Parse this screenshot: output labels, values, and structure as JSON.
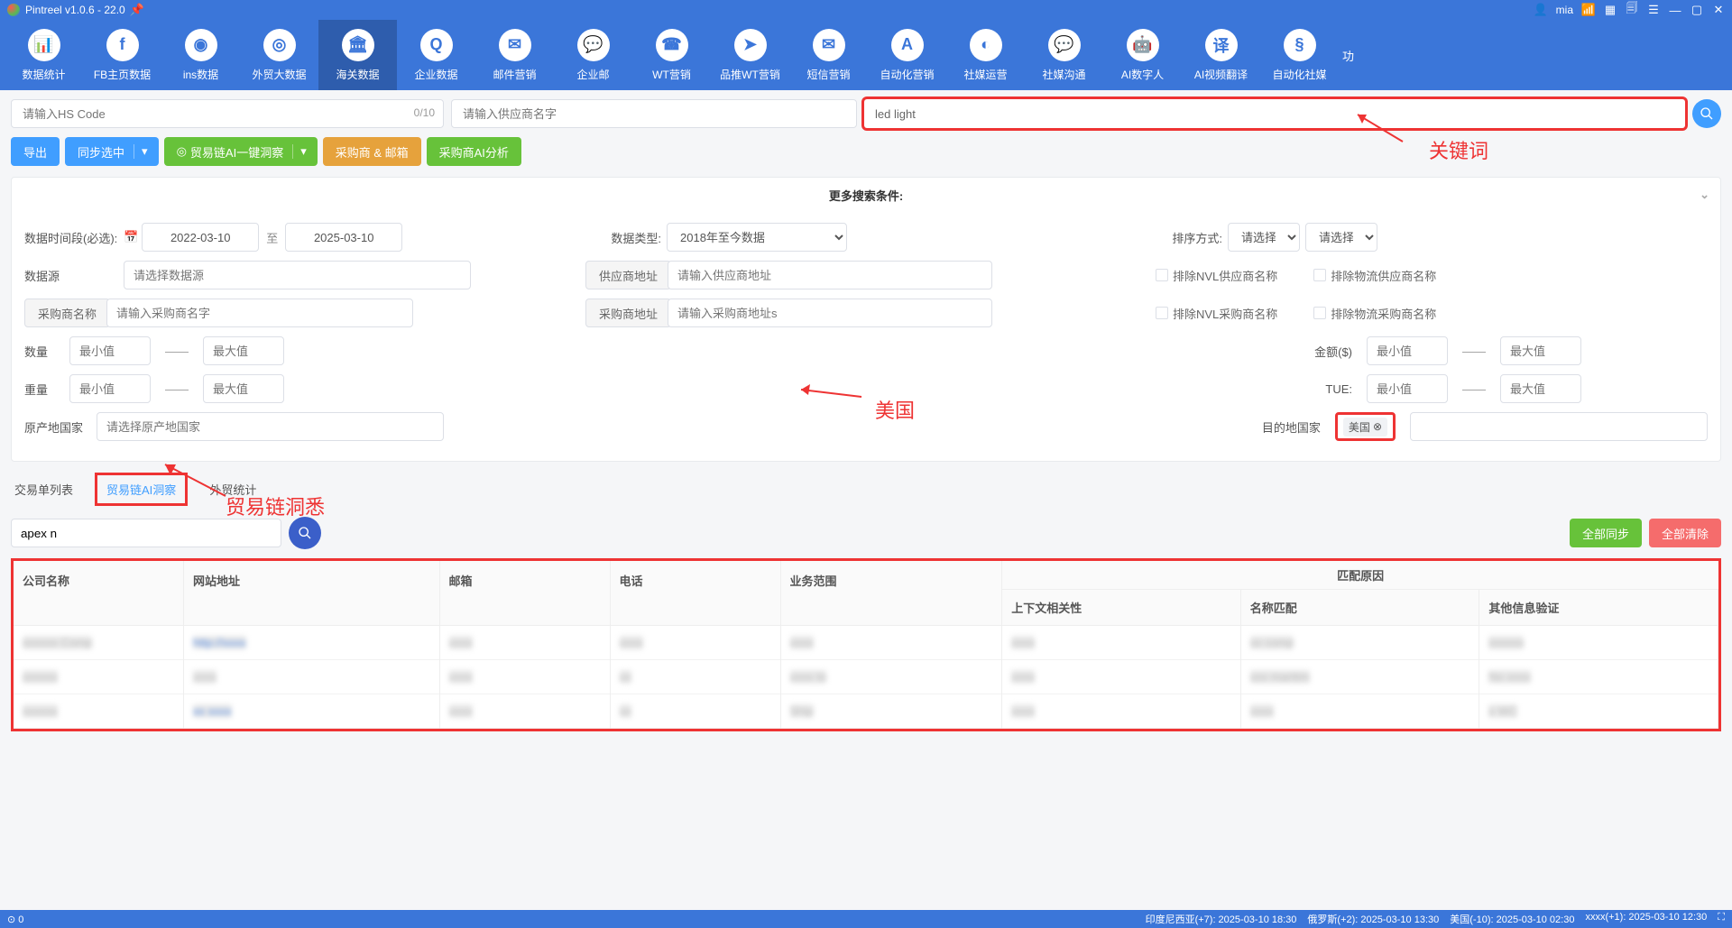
{
  "app_title": "Pintreel v1.0.6 - 22.0",
  "user": "mia",
  "nav": [
    {
      "label": "数据统计",
      "icon": "chart"
    },
    {
      "label": "FB主页数据",
      "icon": "fb"
    },
    {
      "label": "ins数据",
      "icon": "camera"
    },
    {
      "label": "外贸大数据",
      "icon": "globe"
    },
    {
      "label": "海关数据",
      "icon": "customs"
    },
    {
      "label": "企业数据",
      "icon": "refresh"
    },
    {
      "label": "邮件营销",
      "icon": "mail"
    },
    {
      "label": "企业邮",
      "icon": "chat"
    },
    {
      "label": "WT营销",
      "icon": "wa"
    },
    {
      "label": "品推WT营销",
      "icon": "send"
    },
    {
      "label": "短信营销",
      "icon": "sms"
    },
    {
      "label": "自动化营销",
      "icon": "auto"
    },
    {
      "label": "社媒运营",
      "icon": "social"
    },
    {
      "label": "社媒沟通",
      "icon": "talk"
    },
    {
      "label": "AI数字人",
      "icon": "bot"
    },
    {
      "label": "AI视频翻译",
      "icon": "translate"
    },
    {
      "label": "自动化社媒",
      "icon": "rot"
    }
  ],
  "nav_active": 4,
  "search": {
    "hs_placeholder": "请输入HS Code",
    "hs_counter": "0/10",
    "supplier_placeholder": "请输入供应商名字",
    "keyword_value": "led light"
  },
  "actions": {
    "export": "导出",
    "sync_selected": "同步选中",
    "ai_insight": "贸易链AI一键洞察",
    "buyer_mail": "采购商 & 邮箱",
    "buyer_ai": "采购商AI分析"
  },
  "more_conditions": "更多搜索条件:",
  "filters": {
    "date_label": "数据时间段(必选):",
    "date_from": "2022-03-10",
    "date_sep": "至",
    "date_to": "2025-03-10",
    "data_type_label": "数据类型:",
    "data_type_value": "2018年至今数据",
    "sort_label": "排序方式:",
    "sort_placeholder": "请选择",
    "source_label": "数据源",
    "source_placeholder": "请选择数据源",
    "supplier_addr_label": "供应商地址",
    "supplier_addr_placeholder": "请输入供应商地址",
    "exclude_nvl_supplier": "排除NVL供应商名称",
    "exclude_logi_supplier": "排除物流供应商名称",
    "buyer_name_label": "采购商名称",
    "buyer_name_placeholder": "请输入采购商名字",
    "buyer_addr_label": "采购商地址",
    "buyer_addr_placeholder": "请输入采购商地址s",
    "exclude_nvl_buyer": "排除NVL采购商名称",
    "exclude_logi_buyer": "排除物流采购商名称",
    "qty_label": "数量",
    "min_ph": "最小值",
    "max_ph": "最大值",
    "amount_label": "金额($)",
    "weight_label": "重量",
    "tue_label": "TUE:",
    "origin_label": "原产地国家",
    "origin_placeholder": "请选择原产地国家",
    "dest_label": "目的地国家",
    "dest_chip": "美国"
  },
  "tabs": {
    "t1": "交易单列表",
    "t2": "贸易链AI洞察",
    "t3": "外贸统计"
  },
  "query": {
    "value": "apex n",
    "sync_all": "全部同步",
    "clear_all": "全部清除"
  },
  "table": {
    "h_company": "公司名称",
    "h_site": "网站地址",
    "h_email": "邮箱",
    "h_phone": "电话",
    "h_scope": "业务范围",
    "h_reason": "匹配原因",
    "h_context": "上下文相关性",
    "h_name_match": "名称匹配",
    "h_other": "其他信息验证",
    "cells": {
      "r1c1": "xxxxxx Comp",
      "r1c2": "http://xxxx",
      "r1c3": "xxxx",
      "r1c4": "xxxx",
      "r1c5": "xxxx",
      "r1c6": "xxxx",
      "r1c7": "xx comp",
      "r1c8": "xxxxxx",
      "r2c1": "xxxxxx",
      "r2c2": "xxxx",
      "r2c3": "xxxx",
      "r2c4": "xx",
      "r2c5": "xxxx to",
      "r2c6": "xxxx",
      "r2c7": "xxx maritim",
      "r2c8": "No xxxx",
      "r3c1": "xxxxxx",
      "r3c2": "xx xxxx",
      "r3c3": "xxxx",
      "r3c4": "xx",
      "r3c5": "Ship",
      "r3c6": "xxxx",
      "r3c7": "xxxx",
      "r3c8": "x WC"
    }
  },
  "annotations": {
    "keyword_label": "关键词",
    "usa_label": "美国",
    "insight_label": "贸易链洞悉"
  },
  "status": {
    "left": "⊙ 0",
    "tz1": "印度尼西亚(+7): 2025-03-10 18:30",
    "tz2": "俄罗斯(+2): 2025-03-10 13:30",
    "tz3": "美国(-10): 2025-03-10 02:30",
    "tz4": "xxxx(+1): 2025-03-10 12:30"
  }
}
